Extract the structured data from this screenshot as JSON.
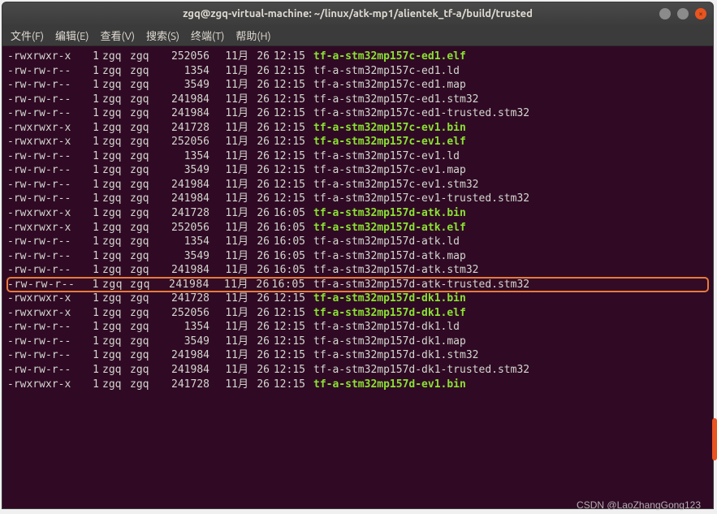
{
  "window": {
    "title": "zgq@zgq-virtual-machine: ~/linux/atk-mp1/alientek_tf-a/build/trusted"
  },
  "menubar": {
    "file": "文件(F)",
    "edit": "编辑(E)",
    "view": "查看(V)",
    "search": "搜索(S)",
    "terminal": "终端(T)",
    "help": "帮助(H)"
  },
  "listing": [
    {
      "perms": "-rwxrwxr-x",
      "links": "1",
      "owner": "zgq",
      "group": "zgq",
      "size": "252056",
      "month": "11月",
      "day": "26",
      "time": "12:15",
      "name": "tf-a-stm32mp157c-ed1.elf",
      "exec": true
    },
    {
      "perms": "-rw-rw-r--",
      "links": "1",
      "owner": "zgq",
      "group": "zgq",
      "size": "1354",
      "month": "11月",
      "day": "26",
      "time": "12:15",
      "name": "tf-a-stm32mp157c-ed1.ld",
      "exec": false
    },
    {
      "perms": "-rw-rw-r--",
      "links": "1",
      "owner": "zgq",
      "group": "zgq",
      "size": "3549",
      "month": "11月",
      "day": "26",
      "time": "12:15",
      "name": "tf-a-stm32mp157c-ed1.map",
      "exec": false
    },
    {
      "perms": "-rw-rw-r--",
      "links": "1",
      "owner": "zgq",
      "group": "zgq",
      "size": "241984",
      "month": "11月",
      "day": "26",
      "time": "12:15",
      "name": "tf-a-stm32mp157c-ed1.stm32",
      "exec": false
    },
    {
      "perms": "-rw-rw-r--",
      "links": "1",
      "owner": "zgq",
      "group": "zgq",
      "size": "241984",
      "month": "11月",
      "day": "26",
      "time": "12:15",
      "name": "tf-a-stm32mp157c-ed1-trusted.stm32",
      "exec": false
    },
    {
      "perms": "-rwxrwxr-x",
      "links": "1",
      "owner": "zgq",
      "group": "zgq",
      "size": "241728",
      "month": "11月",
      "day": "26",
      "time": "12:15",
      "name": "tf-a-stm32mp157c-ev1.bin",
      "exec": true
    },
    {
      "perms": "-rwxrwxr-x",
      "links": "1",
      "owner": "zgq",
      "group": "zgq",
      "size": "252056",
      "month": "11月",
      "day": "26",
      "time": "12:15",
      "name": "tf-a-stm32mp157c-ev1.elf",
      "exec": true
    },
    {
      "perms": "-rw-rw-r--",
      "links": "1",
      "owner": "zgq",
      "group": "zgq",
      "size": "1354",
      "month": "11月",
      "day": "26",
      "time": "12:15",
      "name": "tf-a-stm32mp157c-ev1.ld",
      "exec": false
    },
    {
      "perms": "-rw-rw-r--",
      "links": "1",
      "owner": "zgq",
      "group": "zgq",
      "size": "3549",
      "month": "11月",
      "day": "26",
      "time": "12:15",
      "name": "tf-a-stm32mp157c-ev1.map",
      "exec": false
    },
    {
      "perms": "-rw-rw-r--",
      "links": "1",
      "owner": "zgq",
      "group": "zgq",
      "size": "241984",
      "month": "11月",
      "day": "26",
      "time": "12:15",
      "name": "tf-a-stm32mp157c-ev1.stm32",
      "exec": false
    },
    {
      "perms": "-rw-rw-r--",
      "links": "1",
      "owner": "zgq",
      "group": "zgq",
      "size": "241984",
      "month": "11月",
      "day": "26",
      "time": "12:15",
      "name": "tf-a-stm32mp157c-ev1-trusted.stm32",
      "exec": false
    },
    {
      "perms": "-rwxrwxr-x",
      "links": "1",
      "owner": "zgq",
      "group": "zgq",
      "size": "241728",
      "month": "11月",
      "day": "26",
      "time": "16:05",
      "name": "tf-a-stm32mp157d-atk.bin",
      "exec": true
    },
    {
      "perms": "-rwxrwxr-x",
      "links": "1",
      "owner": "zgq",
      "group": "zgq",
      "size": "252056",
      "month": "11月",
      "day": "26",
      "time": "16:05",
      "name": "tf-a-stm32mp157d-atk.elf",
      "exec": true
    },
    {
      "perms": "-rw-rw-r--",
      "links": "1",
      "owner": "zgq",
      "group": "zgq",
      "size": "1354",
      "month": "11月",
      "day": "26",
      "time": "16:05",
      "name": "tf-a-stm32mp157d-atk.ld",
      "exec": false
    },
    {
      "perms": "-rw-rw-r--",
      "links": "1",
      "owner": "zgq",
      "group": "zgq",
      "size": "3549",
      "month": "11月",
      "day": "26",
      "time": "16:05",
      "name": "tf-a-stm32mp157d-atk.map",
      "exec": false
    },
    {
      "perms": "-rw-rw-r--",
      "links": "1",
      "owner": "zgq",
      "group": "zgq",
      "size": "241984",
      "month": "11月",
      "day": "26",
      "time": "16:05",
      "name": "tf-a-stm32mp157d-atk.stm32",
      "exec": false
    },
    {
      "perms": "-rw-rw-r--",
      "links": "1",
      "owner": "zgq",
      "group": "zgq",
      "size": "241984",
      "month": "11月",
      "day": "26",
      "time": "16:05",
      "name": "tf-a-stm32mp157d-atk-trusted.stm32",
      "exec": false,
      "highlight": true
    },
    {
      "perms": "-rwxrwxr-x",
      "links": "1",
      "owner": "zgq",
      "group": "zgq",
      "size": "241728",
      "month": "11月",
      "day": "26",
      "time": "12:15",
      "name": "tf-a-stm32mp157d-dk1.bin",
      "exec": true
    },
    {
      "perms": "-rwxrwxr-x",
      "links": "1",
      "owner": "zgq",
      "group": "zgq",
      "size": "252056",
      "month": "11月",
      "day": "26",
      "time": "12:15",
      "name": "tf-a-stm32mp157d-dk1.elf",
      "exec": true
    },
    {
      "perms": "-rw-rw-r--",
      "links": "1",
      "owner": "zgq",
      "group": "zgq",
      "size": "1354",
      "month": "11月",
      "day": "26",
      "time": "12:15",
      "name": "tf-a-stm32mp157d-dk1.ld",
      "exec": false
    },
    {
      "perms": "-rw-rw-r--",
      "links": "1",
      "owner": "zgq",
      "group": "zgq",
      "size": "3549",
      "month": "11月",
      "day": "26",
      "time": "12:15",
      "name": "tf-a-stm32mp157d-dk1.map",
      "exec": false
    },
    {
      "perms": "-rw-rw-r--",
      "links": "1",
      "owner": "zgq",
      "group": "zgq",
      "size": "241984",
      "month": "11月",
      "day": "26",
      "time": "12:15",
      "name": "tf-a-stm32mp157d-dk1.stm32",
      "exec": false
    },
    {
      "perms": "-rw-rw-r--",
      "links": "1",
      "owner": "zgq",
      "group": "zgq",
      "size": "241984",
      "month": "11月",
      "day": "26",
      "time": "12:15",
      "name": "tf-a-stm32mp157d-dk1-trusted.stm32",
      "exec": false
    },
    {
      "perms": "-rwxrwxr-x",
      "links": "1",
      "owner": "zgq",
      "group": "zgq",
      "size": "241728",
      "month": "11月",
      "day": "26",
      "time": "12:15",
      "name": "tf-a-stm32mp157d-ev1.bin",
      "exec": true
    }
  ],
  "watermark": "CSDN @LaoZhangGong123"
}
